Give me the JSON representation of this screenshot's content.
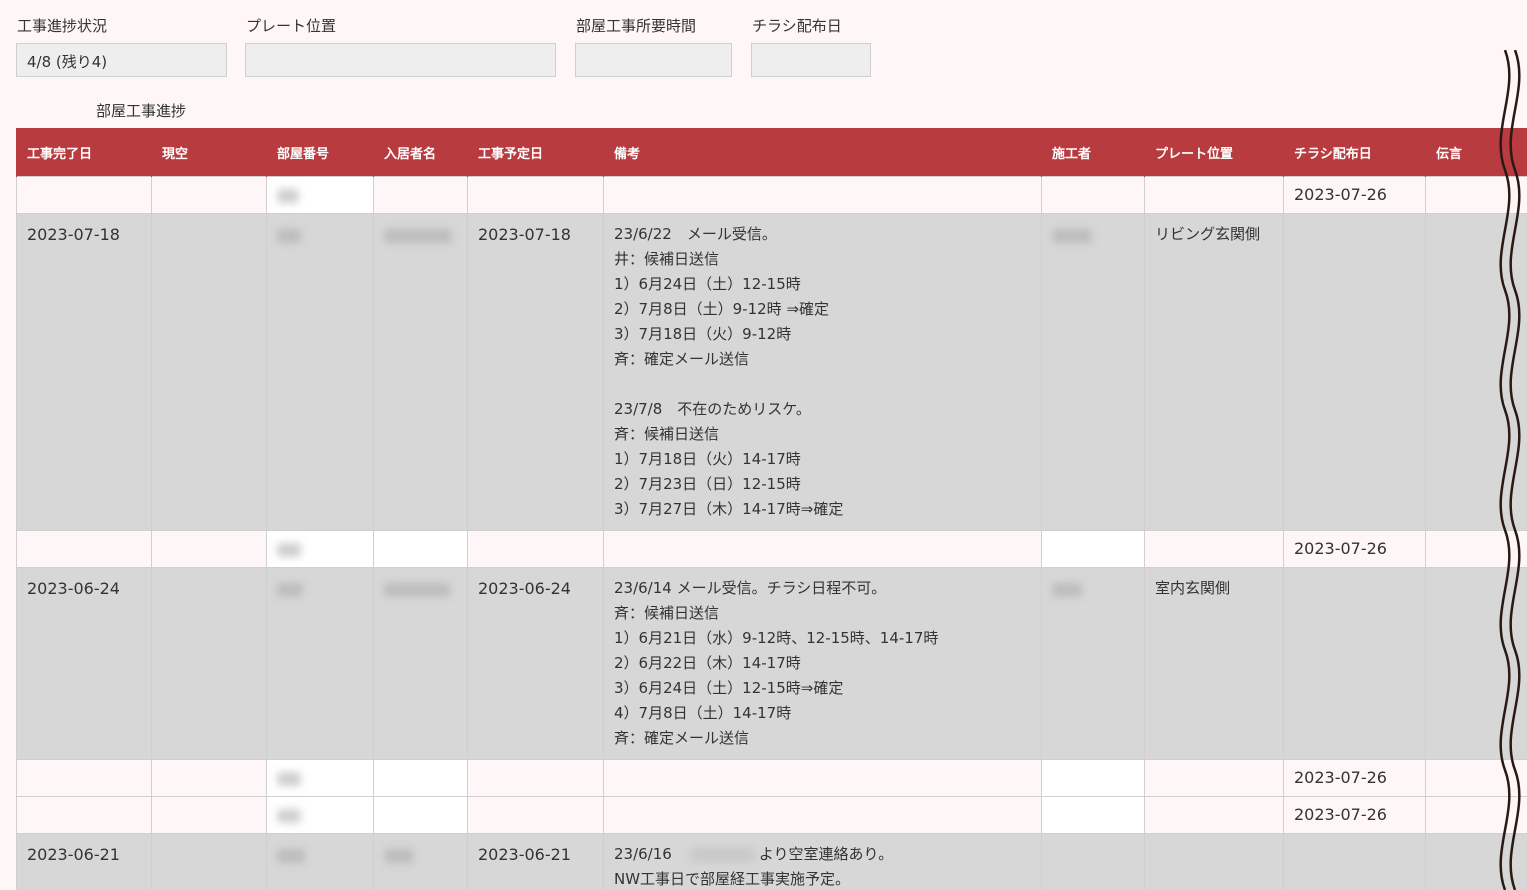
{
  "summary": {
    "progress_label": "工事進捗状況",
    "progress_value": "4/8 (残り4)",
    "plate_label": "プレート位置",
    "plate_value": "",
    "duration_label": "部屋工事所要時間",
    "duration_value": "",
    "flyer_label": "チラシ配布日",
    "flyer_value": ""
  },
  "section_title": "部屋工事進捗",
  "table": {
    "headers": [
      "工事完了日",
      "現空",
      "部屋番号",
      "入居者名",
      "工事予定日",
      "備考",
      "施工者",
      "プレート位置",
      "チラシ配布日",
      "伝言"
    ],
    "rows": [
      {
        "done": "",
        "vacant": "",
        "plan": "",
        "note": "",
        "plate": "",
        "flyer": "2023-07-26"
      },
      {
        "done": "2023-07-18",
        "vacant": "",
        "plan": "2023-07-18",
        "note": "23/6/22　メール受信。\n井：候補日送信\n1）6月24日（土）12-15時\n2）7月8日（土）9-12時 ⇒確定\n3）7月18日（火）9-12時\n斉：確定メール送信\n\n23/7/8　不在のためリスケ。\n斉：候補日送信\n1）7月18日（火）14-17時\n2）7月23日（日）12-15時\n3）7月27日（木）14-17時⇒確定",
        "plate": "リビング玄関側",
        "flyer": ""
      },
      {
        "done": "",
        "vacant": "",
        "plan": "",
        "note": "",
        "plate": "",
        "flyer": "2023-07-26"
      },
      {
        "done": "2023-06-24",
        "vacant": "",
        "plan": "2023-06-24",
        "note": "23/6/14 メール受信。チラシ日程不可。\n斉：候補日送信\n1）6月21日（水）9-12時、12-15時、14-17時\n2）6月22日（木）14-17時\n3）6月24日（土）12-15時⇒確定\n4）7月8日（土）14-17時\n斉：確定メール送信",
        "plate": "室内玄関側",
        "flyer": ""
      },
      {
        "done": "",
        "vacant": "",
        "plan": "",
        "note": "",
        "plate": "",
        "flyer": "2023-07-26"
      },
      {
        "done": "",
        "vacant": "",
        "plan": "",
        "note": "",
        "plate": "",
        "flyer": "2023-07-26"
      },
      {
        "done": "2023-06-21",
        "vacant": "",
        "plan": "2023-06-21",
        "note_pre": "23/6/16　",
        "note_post": "より空室連絡あり。",
        "note_line2": "NW工事日で部屋経工事実施予定。",
        "plate": "",
        "flyer": ""
      }
    ]
  },
  "colors": {
    "header_bg": "#b83b3f",
    "row_bg": "#d7d7d7",
    "page_bg": "#fff7f7"
  }
}
